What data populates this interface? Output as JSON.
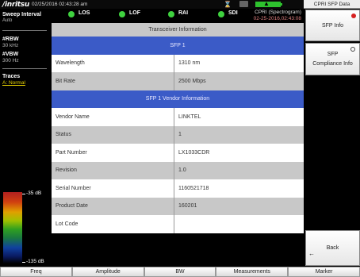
{
  "top_bar": {
    "logo": "/inritsu",
    "datetime": "02/25/2016 02:43:28 am"
  },
  "status": {
    "sweep_title": "Sweep Interval",
    "sweep_value": "Auto",
    "indicators": [
      {
        "label": "LOS",
        "color": "#3fd23f"
      },
      {
        "label": "LOF",
        "color": "#3fd23f"
      },
      {
        "label": "RAI",
        "color": "#3fd23f"
      },
      {
        "label": "SDI",
        "color": "#3fd23f"
      }
    ],
    "mode": "CPRI (Spectrogram)",
    "mode_time": "02-25-2016,02:43:08"
  },
  "left_panel": {
    "rbw_label": "#RBW",
    "rbw_value": "30 kHz",
    "vbw_label": "#VBW",
    "vbw_value": "300 Hz",
    "traces_label": "Traces",
    "traces_value": "A: Normal",
    "scale_top": "-35 dB",
    "scale_bottom": "-135 dB"
  },
  "table": {
    "header": "Transceiver Information",
    "section1_title": "SFP 1",
    "rows1": [
      {
        "label": "Wavelength",
        "value": "1310 nm"
      },
      {
        "label": "Bit Rate",
        "value": "2500 Mbps"
      }
    ],
    "section2_title": "SFP 1 Vendor Information",
    "rows2": [
      {
        "label": "Vendor Name",
        "value": "LINKTEL"
      },
      {
        "label": "Status",
        "value": "1"
      },
      {
        "label": "Part Number",
        "value": "LX1033CDR"
      },
      {
        "label": "Revision",
        "value": "1.0"
      },
      {
        "label": "Serial Number",
        "value": "1160521718"
      },
      {
        "label": "Product Date",
        "value": "160201"
      },
      {
        "label": "Lot Code",
        "value": ""
      }
    ]
  },
  "right_panel": {
    "title": "CPRI SFP Data",
    "sfp_info": "SFP Info",
    "sfp_compliance_line1": "SFP",
    "sfp_compliance_line2": "Compliance Info",
    "back": "Back"
  },
  "bottom_menu": [
    "Freq",
    "Amplitude",
    "BW",
    "Measurements",
    "Marker"
  ],
  "colors": {
    "accent_blue": "#3b5bc7",
    "led_green": "#3fd23f",
    "active_red": "#d62020"
  }
}
